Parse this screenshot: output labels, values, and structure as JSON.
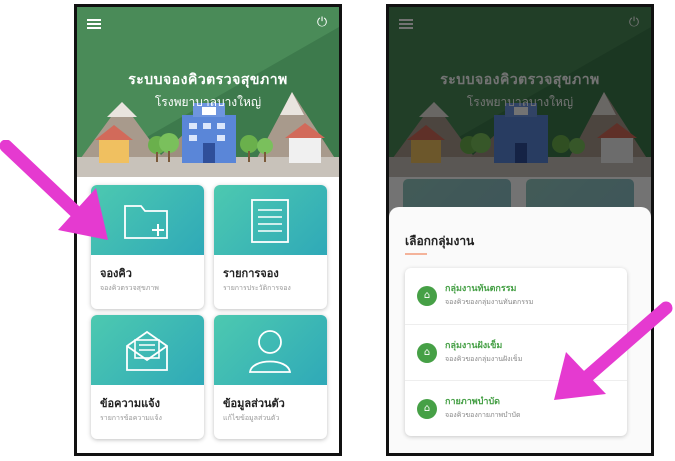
{
  "app": {
    "title": "ระบบจองคิวตรวจสุขภาพ",
    "subtitle": "โรงพยาบาลบางใหญ่"
  },
  "menu_cards": [
    {
      "title": "จองคิว",
      "subtitle": "จองคิวตรวจสุขภาพ",
      "icon": "folder-add-icon"
    },
    {
      "title": "รายการจอง",
      "subtitle": "รายการประวัติการจอง",
      "icon": "list-document-icon"
    },
    {
      "title": "ข้อความแจ้ง",
      "subtitle": "รายการข้อความแจ้ง",
      "icon": "mail-open-icon"
    },
    {
      "title": "ข้อมูลส่วนตัว",
      "subtitle": "แก้ไขข้อมูลส่วนตัว",
      "icon": "user-icon"
    }
  ],
  "group_sheet": {
    "title": "เลือกกลุ่มงาน",
    "items": [
      {
        "title": "กลุ่มงานทันตกรรม",
        "subtitle": "จองคิวของกลุ่มงานทันตกรรม",
        "icon": "hospital-icon"
      },
      {
        "title": "กลุ่มงานฝังเข็ม",
        "subtitle": "จองคิวของกลุ่มงานฝังเข็ม",
        "icon": "hospital-icon"
      },
      {
        "title": "กายภาพบำบัด",
        "subtitle": "จองคิวของกายภาพบำบัด",
        "icon": "hospital-icon"
      }
    ]
  },
  "colors": {
    "accent_teal": "#3fbcb3",
    "header_green": "#3f7d4e",
    "item_green": "#46a046",
    "arrow_pink": "#e53ad0"
  }
}
